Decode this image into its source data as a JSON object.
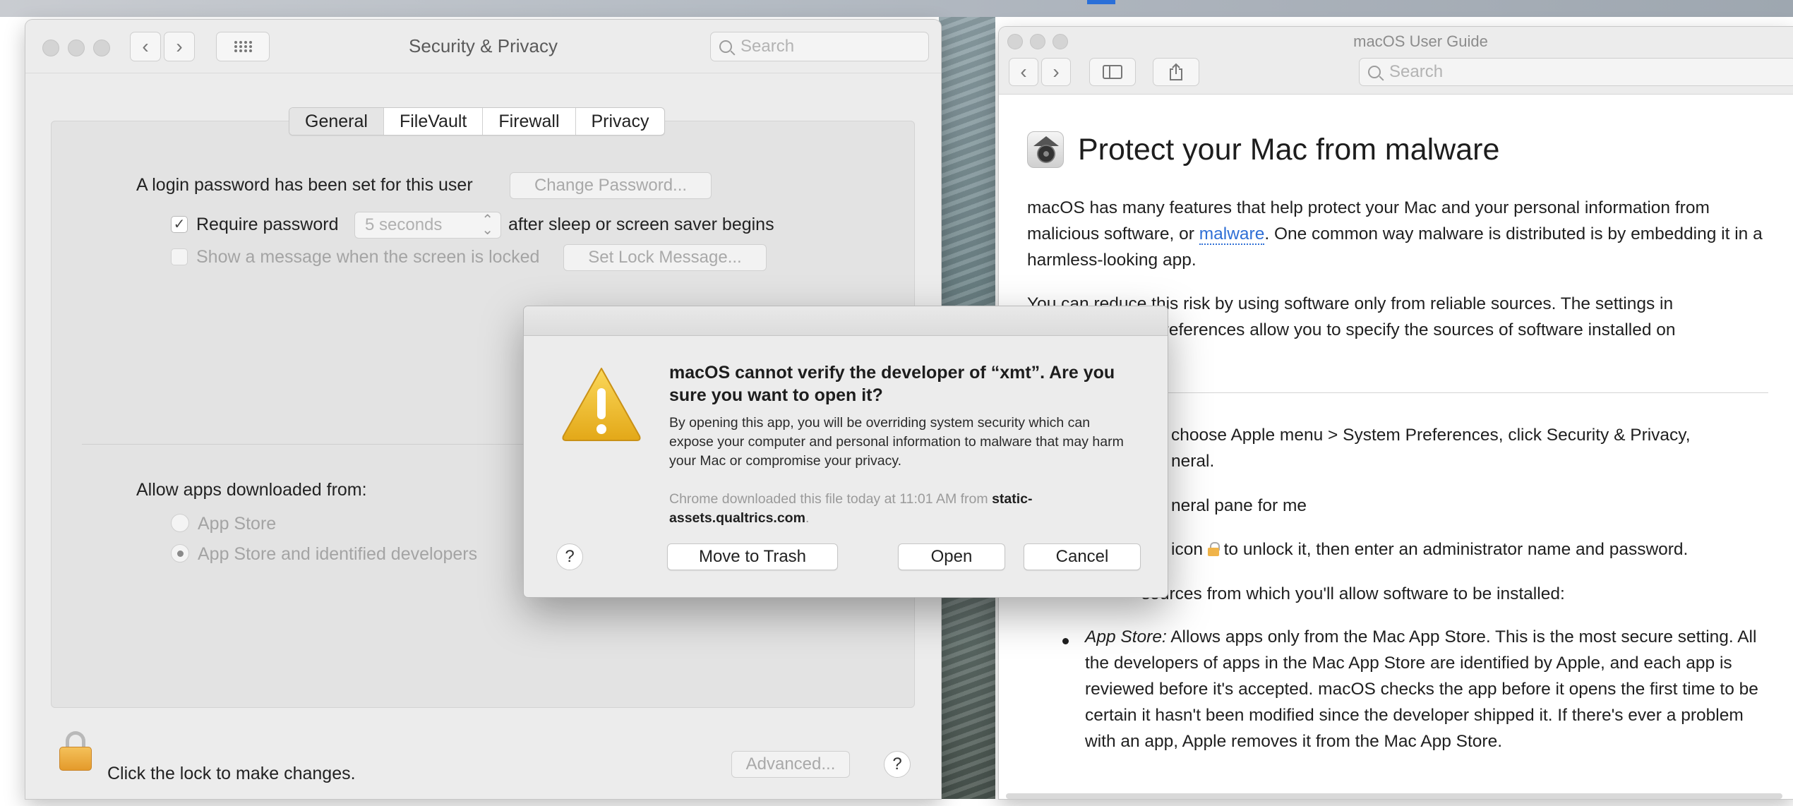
{
  "security_window": {
    "title": "Security & Privacy",
    "search_placeholder": "Search",
    "tabs": [
      "General",
      "FileVault",
      "Firewall",
      "Privacy"
    ],
    "active_tab": "General",
    "login_password_text": "A login password has been set for this user",
    "change_password_button": "Change Password...",
    "require_password_label": "Require password",
    "require_password_checked": true,
    "require_password_delay": "5 seconds",
    "after_sleep_text": "after sleep or screen saver begins",
    "show_message_label": "Show a message when the screen is locked",
    "show_message_checked": false,
    "set_lock_message_button": "Set Lock Message...",
    "allow_apps_label": "Allow apps downloaded from:",
    "allow_options": [
      "App Store",
      "App Store and identified developers"
    ],
    "allow_selected": "App Store and identified developers",
    "lock_text": "Click the lock to make changes.",
    "advanced_button": "Advanced...",
    "help_button": "?"
  },
  "user_guide_window": {
    "title": "macOS User Guide",
    "search_placeholder": "Search",
    "heading": "Protect your Mac from malware",
    "intro_part1": "macOS has many features that help protect your Mac and your personal information from malicious software, or ",
    "intro_link": "malware",
    "intro_part2": ". One common way malware is distributed is by embedding it in a harmless-looking app.",
    "para2_line1": "You can reduce this risk by using software only from reliable sources. The settings in",
    "para2_line2": "y preferences allow you to specify the sources of software installed on",
    "step1_line1": "choose Apple menu  > System Preferences, click Security & Privacy,",
    "step1_line2": "neral.",
    "step1_link": "neral pane for me",
    "step2_prefix": "icon",
    "step2_suffix": "to unlock it, then enter an administrator name and password.",
    "step3": "sources from which you'll allow software to be installed:",
    "bullet_term": "App Store:",
    "bullet_text": " Allows apps only from the Mac App Store. This is the most secure setting. All the developers of apps in the Mac App Store are identified by Apple, and each app is reviewed before it's accepted. macOS checks the app before it opens the first time to be certain it hasn't been modified since the developer shipped it. If there's ever a problem with an app, Apple removes it from the Mac App Store."
  },
  "alert": {
    "title": "macOS cannot verify the developer of “xmt”. Are you sure you want to open it?",
    "body": "By opening this app, you will be overriding system security which can expose your computer and personal information to malware that may harm your Mac or compromise your privacy.",
    "source_prefix": "Chrome downloaded this file today at 11:01 AM from ",
    "source_host": "static-assets.qualtrics.com",
    "source_suffix": ".",
    "help": "?",
    "move_to_trash": "Move to Trash",
    "open": "Open",
    "cancel": "Cancel"
  },
  "colors": {
    "link": "#2f6fd6",
    "lock_gold": "#e49a2b",
    "warning_yellow": "#f2c230"
  }
}
